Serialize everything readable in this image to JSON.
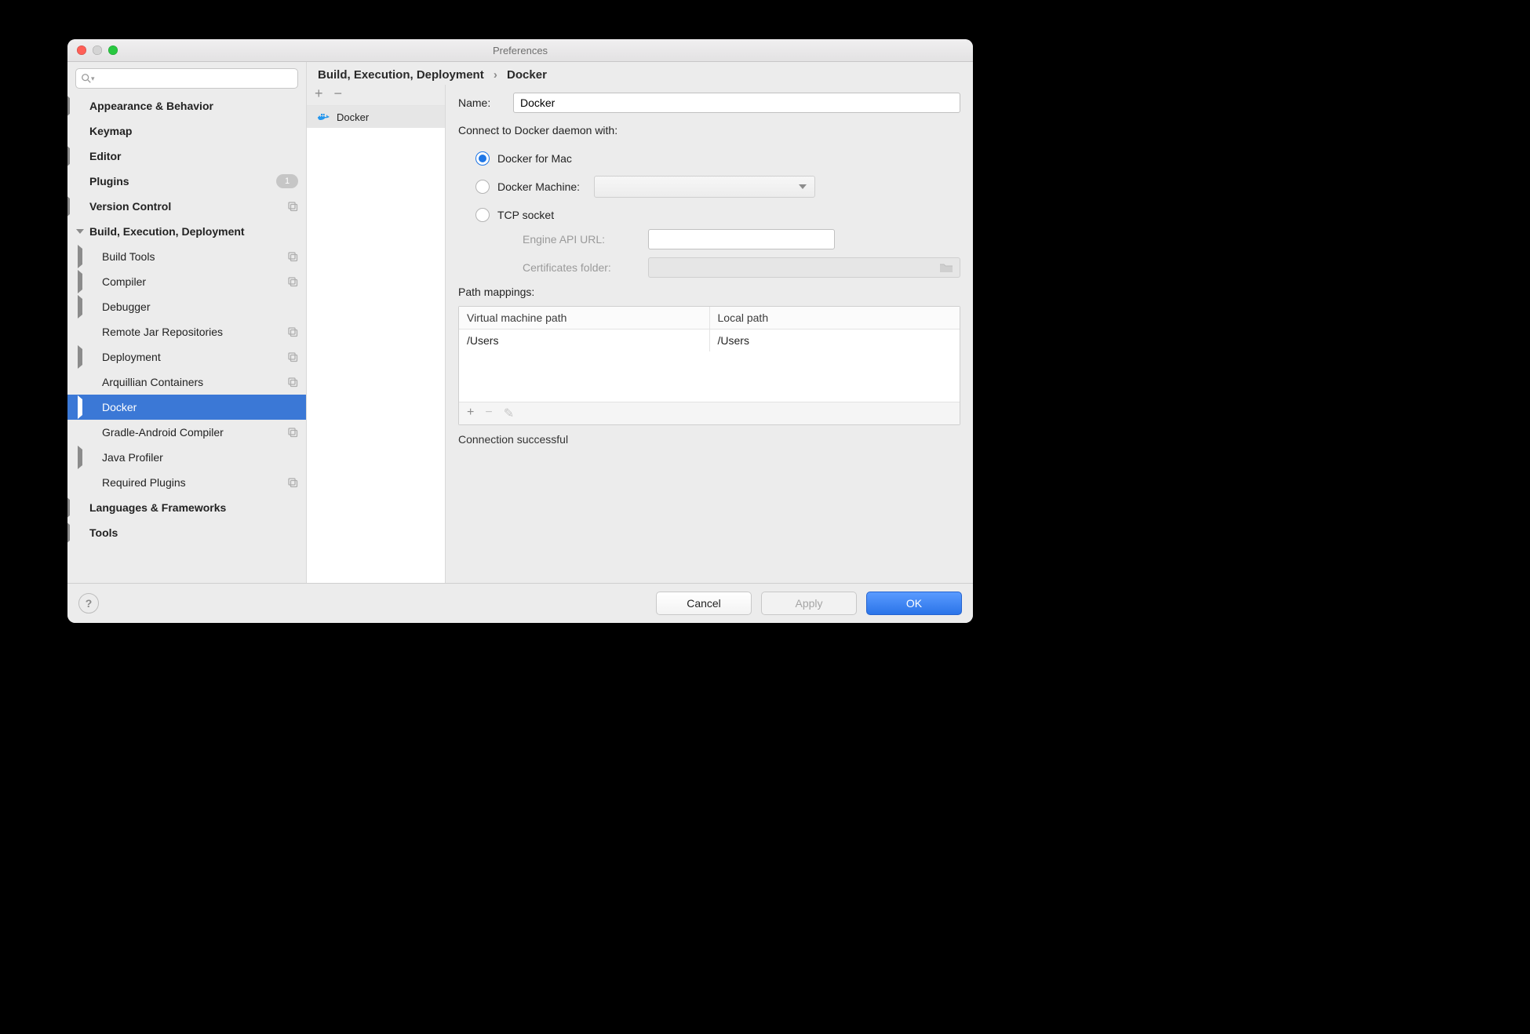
{
  "window": {
    "title": "Preferences"
  },
  "search": {
    "placeholder": ""
  },
  "tree": {
    "appearance": "Appearance & Behavior",
    "keymap": "Keymap",
    "editor": "Editor",
    "plugins": "Plugins",
    "plugins_badge": "1",
    "version_control": "Version Control",
    "bed": "Build, Execution, Deployment",
    "build_tools": "Build Tools",
    "compiler": "Compiler",
    "debugger": "Debugger",
    "remote_jar": "Remote Jar Repositories",
    "deployment": "Deployment",
    "arquillian": "Arquillian Containers",
    "docker": "Docker",
    "gradle_android": "Gradle-Android Compiler",
    "java_profiler": "Java Profiler",
    "required_plugins": "Required Plugins",
    "lang_fw": "Languages & Frameworks",
    "tools": "Tools"
  },
  "crumbs": {
    "a": "Build, Execution, Deployment",
    "b": "Docker"
  },
  "midlist": {
    "docker": "Docker"
  },
  "plusminus": {
    "plus": "+",
    "minus": "−"
  },
  "form": {
    "name_label": "Name:",
    "name_value": "Docker",
    "connect_label": "Connect to Docker daemon with:",
    "radio_mac": "Docker for Mac",
    "radio_machine": "Docker Machine:",
    "radio_tcp": "TCP socket",
    "engine_label": "Engine API URL:",
    "certs_label": "Certificates folder:",
    "path_label": "Path mappings:",
    "vm_header": "Virtual machine path",
    "local_header": "Local path",
    "vm_val": "/Users",
    "local_val": "/Users",
    "status": "Connection successful"
  },
  "ptoolbar": {
    "plus": "+",
    "minus": "−",
    "edit": "✎"
  },
  "footer": {
    "help": "?",
    "cancel": "Cancel",
    "apply": "Apply",
    "ok": "OK"
  }
}
